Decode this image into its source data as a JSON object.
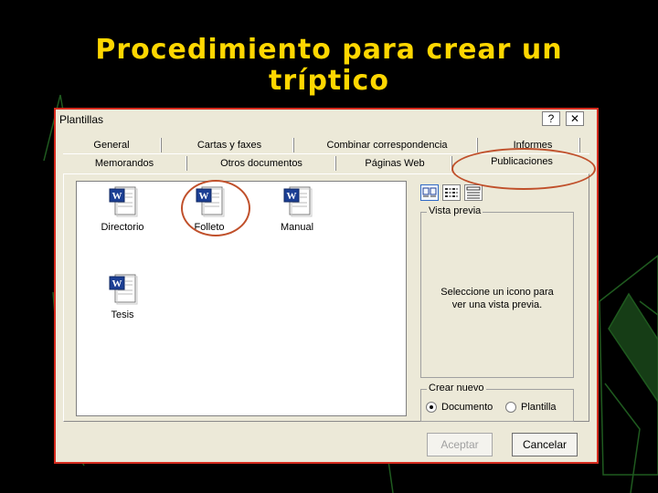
{
  "slide": {
    "title": "Procedimiento para crear un tríptico"
  },
  "dialog": {
    "title": "Plantillas",
    "help_button": "?",
    "close_button": "✕",
    "tabs_row1": [
      "General",
      "Cartas y faxes",
      "Combinar correspondencia",
      "Informes"
    ],
    "tabs_row2": [
      "Memorandos",
      "Otros documentos",
      "Páginas Web",
      "Publicaciones"
    ],
    "files": [
      {
        "label": "Directorio",
        "icon": "word-document-icon"
      },
      {
        "label": "Folleto",
        "icon": "word-document-icon"
      },
      {
        "label": "Manual",
        "icon": "word-document-icon"
      },
      {
        "label": "Tesis",
        "icon": "word-document-icon"
      }
    ],
    "view_modes": [
      "large-icons-icon",
      "list-view-icon",
      "details-view-icon"
    ],
    "preview": {
      "legend": "Vista previa",
      "message": "Seleccione un icono para ver una vista previa."
    },
    "create_new": {
      "legend": "Crear nuevo",
      "options": [
        "Documento",
        "Plantilla"
      ],
      "selected": "Documento"
    },
    "buttons": {
      "accept": "Aceptar",
      "cancel": "Cancelar"
    }
  },
  "colors": {
    "title": "#ffd700",
    "dialog_border": "#d52b1e",
    "annotation": "#c0502b",
    "decoration": "#1f5a1f"
  }
}
